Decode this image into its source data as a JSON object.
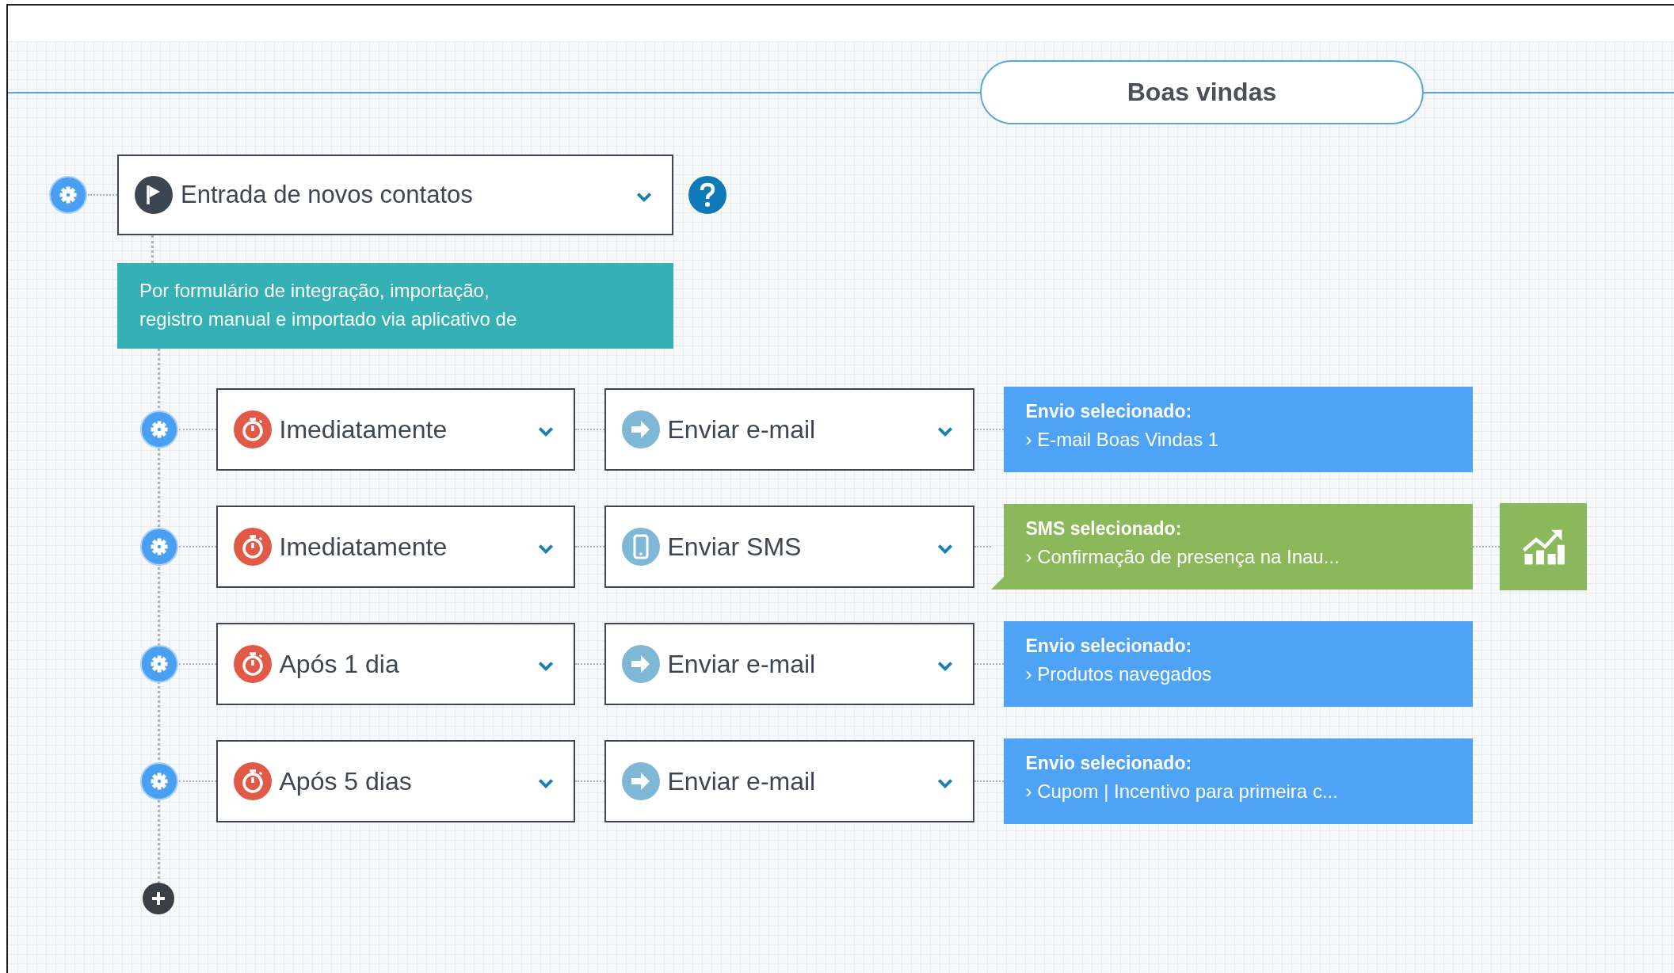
{
  "title": "Boas vindas",
  "trigger": {
    "label": "Entrada de novos contatos",
    "description": "Por formulário de integração, importação,\nregistro manual e importado via aplicativo de"
  },
  "steps": [
    {
      "timing": "Imediatamente",
      "action": {
        "kind": "email",
        "label": "Enviar e-mail"
      },
      "card": {
        "kind": "email",
        "heading": "Envio selecionado:",
        "detail": "› E-mail Boas Vindas 1",
        "selected": false
      },
      "report": false
    },
    {
      "timing": "Imediatamente",
      "action": {
        "kind": "sms",
        "label": "Enviar SMS"
      },
      "card": {
        "kind": "sms",
        "heading": "SMS selecionado:",
        "detail": "› Confirmação de presença na Inau...",
        "selected": true
      },
      "report": true
    },
    {
      "timing": "Após 1 dia",
      "action": {
        "kind": "email",
        "label": "Enviar e-mail"
      },
      "card": {
        "kind": "email",
        "heading": "Envio selecionado:",
        "detail": "› Produtos navegados",
        "selected": false
      },
      "report": false
    },
    {
      "timing": "Após 5 dias",
      "action": {
        "kind": "email",
        "label": "Enviar e-mail"
      },
      "card": {
        "kind": "email",
        "heading": "Envio selecionado:",
        "detail": "› Cupom | Incentivo para primeira c...",
        "selected": false
      },
      "report": false
    }
  ]
}
